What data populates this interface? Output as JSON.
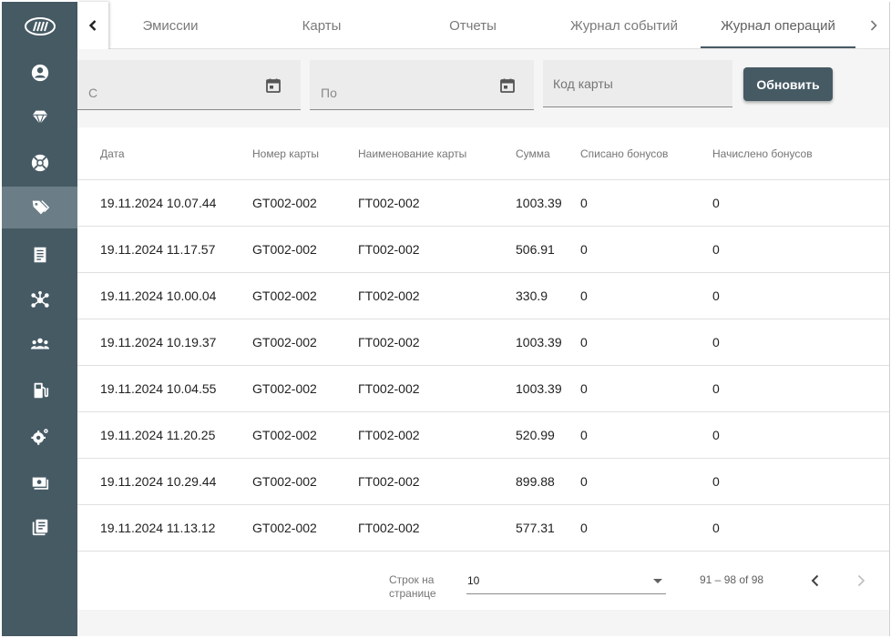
{
  "colors": {
    "sidebar": "#465a64",
    "sidebar_active": "#6b7e87",
    "accent": "#465a64"
  },
  "sidebar": {
    "logo": "logo-icon",
    "items": [
      {
        "icon": "user-icon",
        "active": false
      },
      {
        "icon": "diamond-icon",
        "active": false
      },
      {
        "icon": "lifebuoy-icon",
        "active": false
      },
      {
        "icon": "tags-icon",
        "active": true
      },
      {
        "icon": "receipt-icon",
        "active": false
      },
      {
        "icon": "network-icon",
        "active": false
      },
      {
        "icon": "users-icon",
        "active": false
      },
      {
        "icon": "fuel-station-icon",
        "active": false
      },
      {
        "icon": "gears-icon",
        "active": false
      },
      {
        "icon": "money-icon",
        "active": false
      },
      {
        "icon": "news-icon",
        "active": false
      }
    ]
  },
  "tabs": {
    "items": [
      {
        "label": "Эмиссии"
      },
      {
        "label": "Карты"
      },
      {
        "label": "Отчеты"
      },
      {
        "label": "Журнал событий"
      },
      {
        "label": "Журнал операций"
      }
    ],
    "active_index": 4
  },
  "filters": {
    "from_placeholder": "С",
    "to_placeholder": "По",
    "card_code_placeholder": "Код карты",
    "refresh_label": "Обновить"
  },
  "table": {
    "columns": [
      "Дата",
      "Номер карты",
      "Наименование карты",
      "Сумма",
      "Списано бонусов",
      "Начислено бонусов"
    ],
    "rows": [
      [
        "19.11.2024 10.07.44",
        "GT002-002",
        "ГТ002-002",
        "1003.39",
        "0",
        "0"
      ],
      [
        "19.11.2024 11.17.57",
        "GT002-002",
        "ГТ002-002",
        "506.91",
        "0",
        "0"
      ],
      [
        "19.11.2024 10.00.04",
        "GT002-002",
        "ГТ002-002",
        "330.9",
        "0",
        "0"
      ],
      [
        "19.11.2024 10.19.37",
        "GT002-002",
        "ГТ002-002",
        "1003.39",
        "0",
        "0"
      ],
      [
        "19.11.2024 10.04.55",
        "GT002-002",
        "ГТ002-002",
        "1003.39",
        "0",
        "0"
      ],
      [
        "19.11.2024 11.20.25",
        "GT002-002",
        "ГТ002-002",
        "520.99",
        "0",
        "0"
      ],
      [
        "19.11.2024 10.29.44",
        "GT002-002",
        "ГТ002-002",
        "899.88",
        "0",
        "0"
      ],
      [
        "19.11.2024 11.13.12",
        "GT002-002",
        "ГТ002-002",
        "577.31",
        "0",
        "0"
      ]
    ]
  },
  "paginator": {
    "rows_label_line1": "Строк на",
    "rows_label_line2": "странице",
    "page_size": "10",
    "range": "91 – 98 of 98"
  }
}
